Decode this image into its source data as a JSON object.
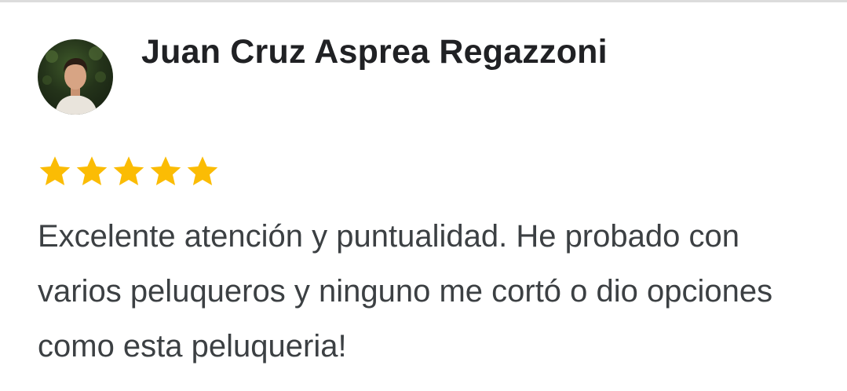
{
  "review": {
    "reviewer_name": "Juan Cruz Asprea Regazzoni",
    "avatar_icon": "profile-photo",
    "rating": 5,
    "rating_max": 5,
    "text": "Excelente atención y puntualidad. He probado con varios peluqueros y ninguno me cortó o dio opciones como esta peluqueria!"
  },
  "colors": {
    "star": "#FBBC04",
    "name_text": "#202124",
    "body_text": "#3C4043",
    "top_rule": "#DCDCDC"
  }
}
